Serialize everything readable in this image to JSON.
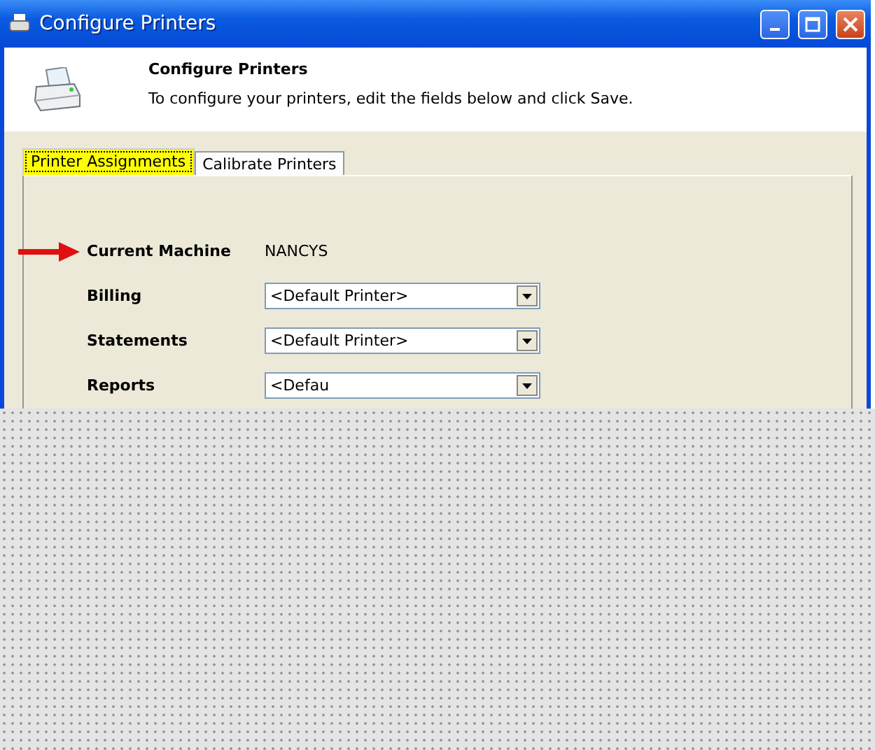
{
  "window": {
    "title": "Configure Printers"
  },
  "header": {
    "title": "Configure Printers",
    "description": "To configure your printers, edit the fields below and click Save."
  },
  "tabs": [
    {
      "label": "Printer Assignments",
      "selected": true
    },
    {
      "label": "Calibrate Printers",
      "selected": false
    }
  ],
  "current_machine": {
    "label": "Current Machine",
    "value": "NANCYS"
  },
  "printer_fields": [
    {
      "label": "Billing",
      "value": "<Default Printer>"
    },
    {
      "label": "Statements",
      "value": "<Default Printer>"
    },
    {
      "label": "Reports",
      "value": "<Defau"
    }
  ]
}
